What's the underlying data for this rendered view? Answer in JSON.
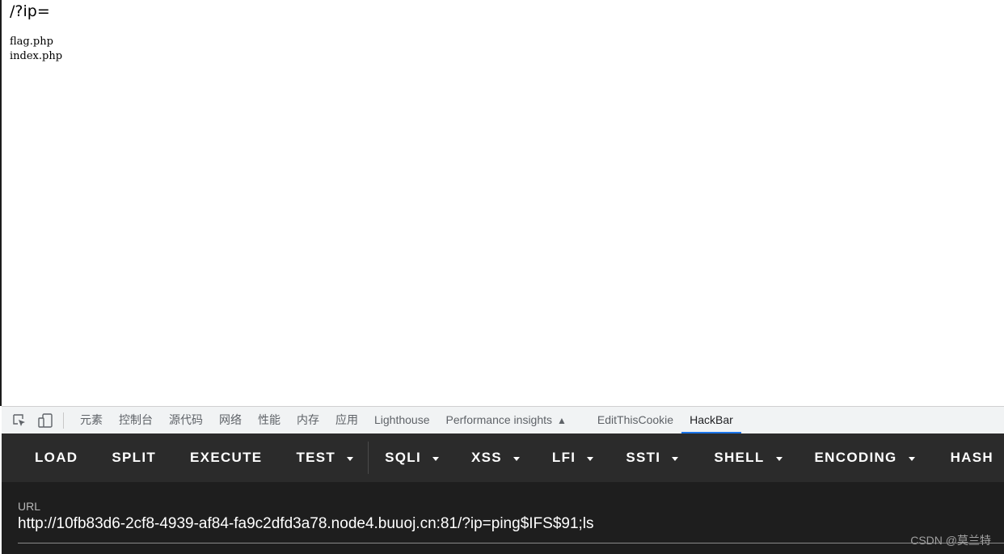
{
  "page": {
    "title": "/?ip=",
    "files": [
      "flag.php",
      "index.php"
    ]
  },
  "devtools": {
    "icons": [
      "inspect-element-icon",
      "device-toggle-icon"
    ],
    "tabs": [
      {
        "label": "元素"
      },
      {
        "label": "控制台"
      },
      {
        "label": "源代码"
      },
      {
        "label": "网络"
      },
      {
        "label": "性能"
      },
      {
        "label": "内存"
      },
      {
        "label": "应用"
      },
      {
        "label": "Lighthouse"
      },
      {
        "label": "Performance insights"
      },
      {
        "label": "EditThisCookie"
      },
      {
        "label": "HackBar",
        "active": true
      }
    ],
    "accent": "#1a73e8"
  },
  "hackbar": {
    "buttons": [
      {
        "label": "LOAD"
      },
      {
        "label": "SPLIT"
      },
      {
        "label": "EXECUTE"
      },
      {
        "label": "TEST"
      },
      {
        "label": "SQLI"
      },
      {
        "label": "XSS"
      },
      {
        "label": "LFI"
      },
      {
        "label": "SSTI"
      },
      {
        "label": "SHELL"
      },
      {
        "label": "ENCODING"
      },
      {
        "label": "HASH"
      }
    ],
    "url_label": "URL",
    "url_value": "http://10fb83d6-2cf8-4939-af84-fa9c2dfd3a78.node4.buuoj.cn:81/?ip=ping$IFS$91;ls",
    "toolbar_color": "#2b2b2b",
    "panel_color": "#1e1e1e"
  },
  "watermark": "CSDN @莫兰特"
}
